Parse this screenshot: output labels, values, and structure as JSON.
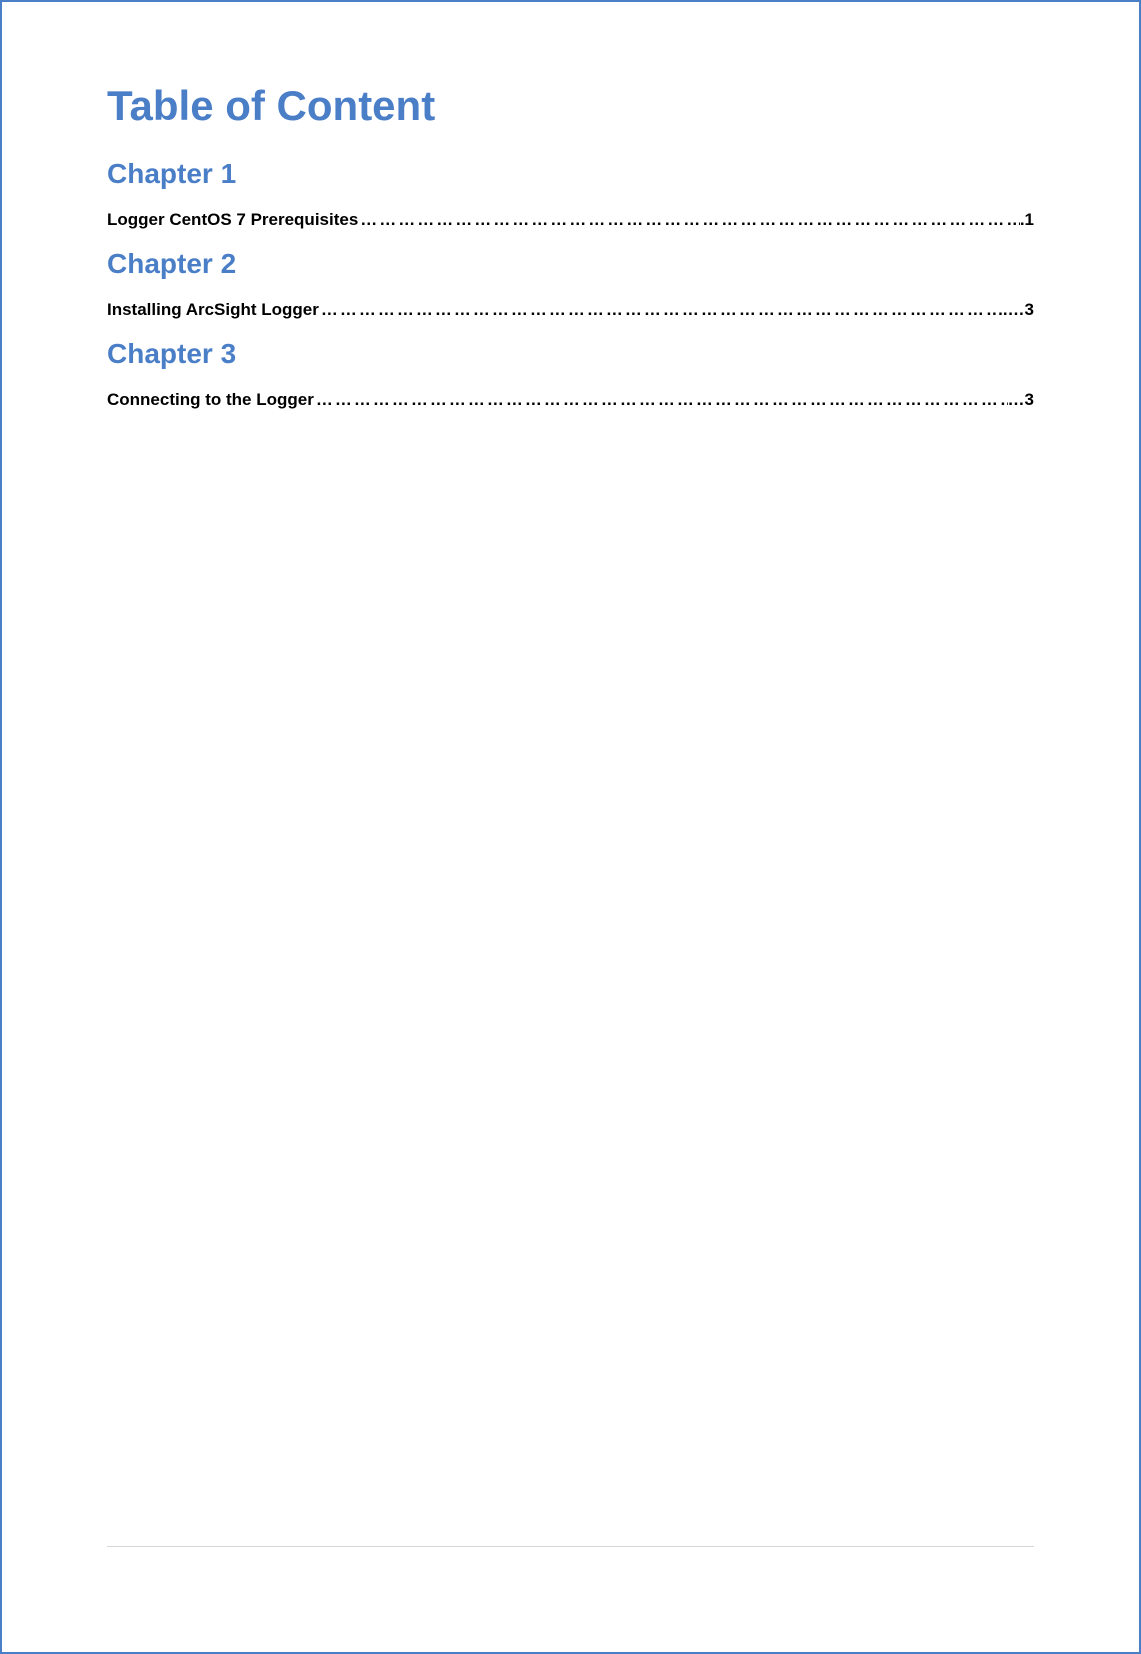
{
  "title": "Table of Content",
  "chapters": [
    {
      "heading": "Chapter 1",
      "entry_label": "Logger CentOS 7 Prerequisites ",
      "entry_page": ".1"
    },
    {
      "heading": "Chapter 2",
      "entry_label": "Installing ArcSight Logger ",
      "entry_page": "..…3"
    },
    {
      "heading": "Chapter 3",
      "entry_label": "Connecting to the Logger ",
      "entry_page": "…3"
    }
  ]
}
